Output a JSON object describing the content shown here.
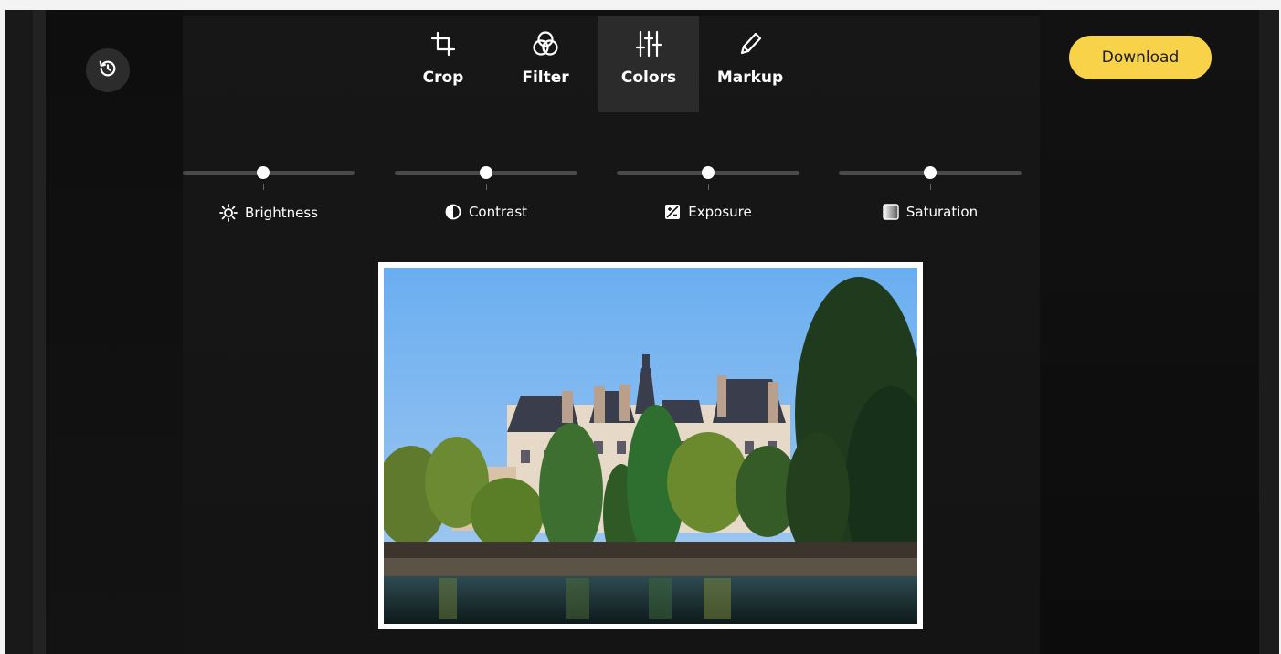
{
  "toolbar": {
    "tools": [
      {
        "label": "Crop",
        "icon": "crop-icon"
      },
      {
        "label": "Filter",
        "icon": "filter-icon"
      },
      {
        "label": "Colors",
        "icon": "sliders-icon",
        "active": true
      },
      {
        "label": "Markup",
        "icon": "pencil-icon"
      }
    ],
    "download_label": "Download",
    "history_icon": "history-icon"
  },
  "adjustments": [
    {
      "label": "Brightness",
      "icon": "sun-icon",
      "value": 0.5
    },
    {
      "label": "Contrast",
      "icon": "contrast-icon",
      "value": 0.5
    },
    {
      "label": "Exposure",
      "icon": "exposure-icon",
      "value": 0.5
    },
    {
      "label": "Saturation",
      "icon": "saturation-icon",
      "value": 0.5
    }
  ],
  "colors": {
    "accent": "#f8d34a",
    "active_tool_bg": "#2b2b2b",
    "background": "#101010"
  }
}
